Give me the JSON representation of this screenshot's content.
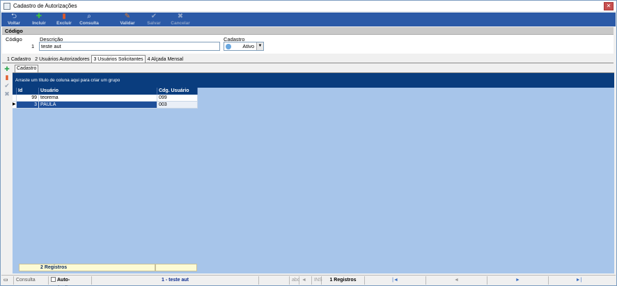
{
  "window": {
    "title": "Cadastro de Autorizações",
    "close": "✕"
  },
  "toolbar": {
    "buttons": [
      {
        "label": "Voltar",
        "icon": "undo-icon",
        "glyph": "⮌",
        "color": "#dce6f5"
      },
      {
        "label": "Incluir",
        "icon": "plus-icon",
        "glyph": "✚",
        "color": "#3fbf3f"
      },
      {
        "label": "Excluir",
        "icon": "delete-icon",
        "glyph": "▮",
        "color": "#e05a2a"
      },
      {
        "label": "Consulta",
        "icon": "search-icon",
        "glyph": "⌕",
        "color": "#dfe7f7"
      },
      {
        "label": "Validar",
        "icon": "validate-icon",
        "glyph": "✎",
        "color": "#e07a2a"
      },
      {
        "label": "Salvar",
        "icon": "check-icon",
        "glyph": "✔",
        "color": "#8ea3c7"
      },
      {
        "label": "Cancelar",
        "icon": "cancel-icon",
        "glyph": "✖",
        "color": "#8ea3c7"
      }
    ]
  },
  "section": {
    "title": "Código"
  },
  "form": {
    "code_label": "Código",
    "code_value": "1",
    "desc_label": "Descrição",
    "desc_value": "teste aut",
    "cad_label": "Cadastro",
    "cad_value": "Ativo",
    "cad_arrow": "▼"
  },
  "tabs": [
    {
      "label": "1 Cadastro"
    },
    {
      "label": "2 Usuários Autorizadores"
    },
    {
      "label": "3 Usuários Solicitantes"
    },
    {
      "label": "4 Alçada Mensal"
    }
  ],
  "left_strip": [
    {
      "icon": "add-icon",
      "glyph": "✚",
      "color": "#2fa84f"
    },
    {
      "icon": "delete-icon",
      "glyph": "▮",
      "color": "#e05a2a"
    },
    {
      "icon": "check-icon",
      "glyph": "✔",
      "color": "#9aa6b6"
    },
    {
      "icon": "cancel-icon",
      "glyph": "✖",
      "color": "#9aa6b6"
    }
  ],
  "inner_tab": "Cadastro",
  "grid": {
    "group_hint": "Arraste um título de coluna aqui para criar um grupo",
    "columns": [
      "Id",
      "Usuário",
      "Cdg. Usuário"
    ],
    "rows": [
      {
        "id": "99",
        "user": "teorema",
        "code": "099"
      },
      {
        "id": "3",
        "user": "PAULA",
        "code": "003"
      }
    ],
    "row_pointer": "▶",
    "footer": "2 Registros"
  },
  "status": {
    "mode": "Consulta",
    "auto_inclusao": "Auto-Inclusão",
    "record": "1 - teste aut",
    "abc": "abc",
    "arrows": "◄ ►",
    "ins": "INS",
    "count": "1 Registros",
    "first": "|◄",
    "prev": "◄",
    "next": "►",
    "last": "►|"
  }
}
